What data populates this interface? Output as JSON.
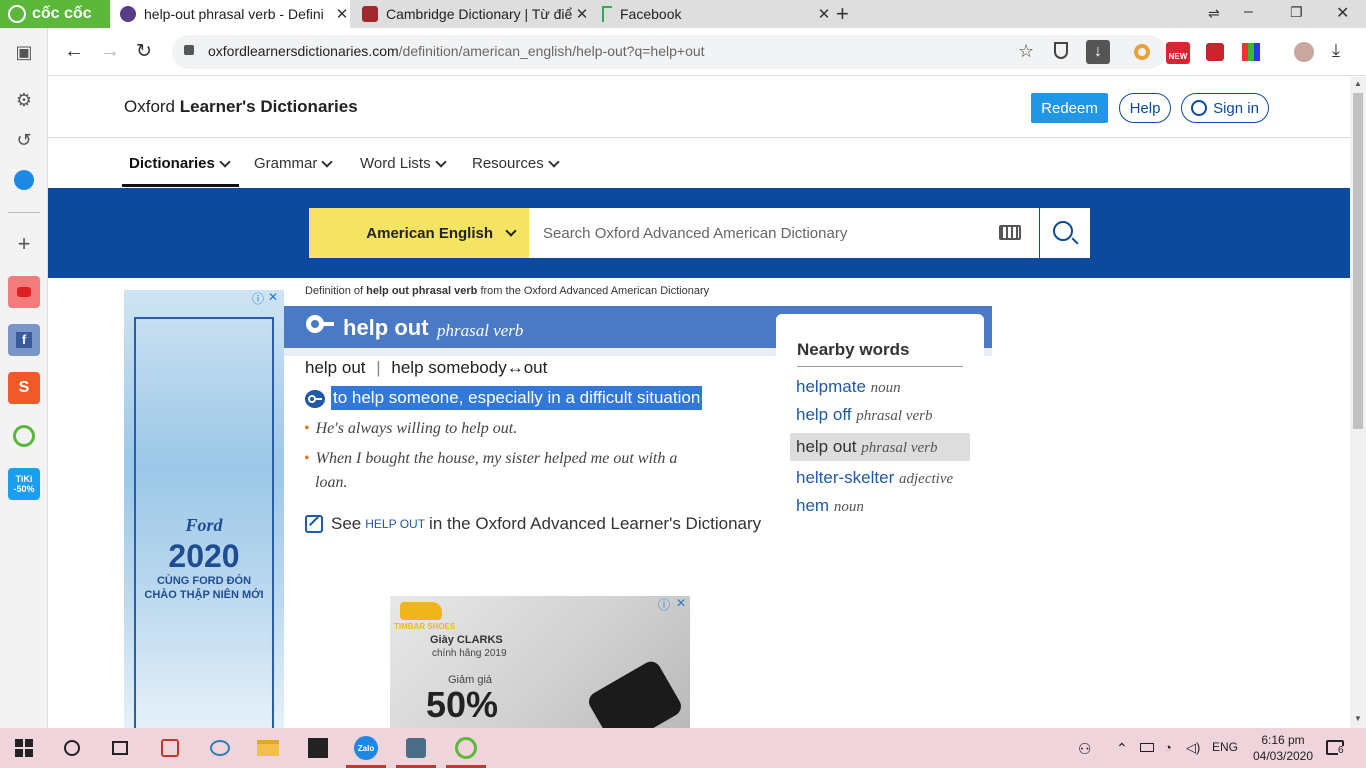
{
  "browser": {
    "brand": "cốc cốc",
    "tabs": [
      {
        "title": "help-out phrasal verb - Defini",
        "active": true
      },
      {
        "title": "Cambridge Dictionary | Từ điể",
        "active": false
      },
      {
        "title": "Facebook",
        "active": false
      }
    ],
    "new_tab": "+",
    "url_host": "oxfordlearnersdictionaries.com",
    "url_path": "/definition/american_english/help-out?q=help+out",
    "window_controls": {
      "minimize": "–",
      "restore": "❐",
      "close": "✕"
    }
  },
  "sidebar_icons": [
    "panel-icon",
    "gear-icon",
    "history-icon",
    "messenger-icon",
    "add-icon",
    "youtube-icon",
    "facebook-icon",
    "shopee-icon",
    "coccoc-icon",
    "tiki-icon"
  ],
  "sidebar": {
    "tiki_line1": "TiKi",
    "tiki_line2": "-50%"
  },
  "site": {
    "logo_plain": "Oxford ",
    "logo_bold": "Learner's Dictionaries",
    "redeem": "Redeem",
    "help": "Help",
    "signin": "Sign in",
    "nav": [
      "Dictionaries",
      "Grammar",
      "Word Lists",
      "Resources"
    ],
    "search_dict": "American English",
    "search_placeholder": "Search Oxford Advanced American Dictionary"
  },
  "entry": {
    "breadcrumb_pre": "Definition of ",
    "breadcrumb_bold": "help out phrasal verb",
    "breadcrumb_post": " from the Oxford Advanced American Dictionary",
    "headword": "help out",
    "pos": "phrasal verb",
    "form1": "help out",
    "separator": "|",
    "form2": "help somebody↔out",
    "definition": "to help someone, especially in a difficult situation",
    "examples": [
      "He's always willing to help out.",
      "When I bought the house, my sister helped me out with a",
      "loan."
    ],
    "see_pre": "See ",
    "see_link": "HELP OUT",
    "see_post": " in the Oxford Advanced Learner's Dictionary"
  },
  "nearby": {
    "title": "Nearby words",
    "items": [
      {
        "word": "helpmate",
        "pos": "noun"
      },
      {
        "word": "help off",
        "pos": "phrasal verb"
      },
      {
        "word": "help out",
        "pos": "phrasal verb",
        "selected": true
      },
      {
        "word": "helter-skelter",
        "pos": "adjective"
      },
      {
        "word": "hem",
        "pos": "noun"
      }
    ]
  },
  "ads": {
    "left_brand": "Ford",
    "left_year": "2020",
    "left_line1": "CÙNG FORD ĐÓN",
    "left_line2": "CHÀO THẬP NIÊN MỚI",
    "bottom_store": "TIMBAR SHOES",
    "bottom_line1": "Giày CLARKS",
    "bottom_line2": "chính hãng 2019",
    "bottom_line3": "Giảm giá",
    "bottom_discount": "50%",
    "ad_close": "✕",
    "ad_info": "ⓘ"
  },
  "taskbar": {
    "lang": "ENG",
    "time": "6:16 pm",
    "date": "04/03/2020",
    "notifications": "6"
  },
  "colors": {
    "accent_blue": "#0d4a9e",
    "header_blue": "#4a7ac6",
    "yellow": "#f5e463",
    "redeem": "#2196e6",
    "highlight": "#3178d8"
  }
}
